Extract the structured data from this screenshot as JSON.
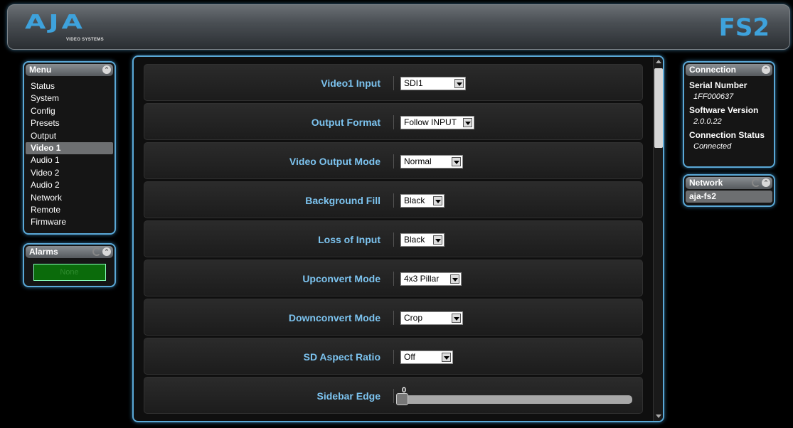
{
  "header": {
    "logo_text": "AJA",
    "logo_sub": "VIDEO SYSTEMS",
    "model": "FS2"
  },
  "menu": {
    "title": "Menu",
    "items": [
      "Status",
      "System",
      "Config",
      "Presets",
      "Output",
      "Video 1",
      "Audio 1",
      "Video 2",
      "Audio 2",
      "Network",
      "Remote",
      "Firmware"
    ],
    "active": "Video 1"
  },
  "alarms": {
    "title": "Alarms",
    "status": "None"
  },
  "connection": {
    "title": "Connection",
    "serial_label": "Serial Number",
    "serial_value": "1FF000637",
    "software_label": "Software Version",
    "software_value": "2.0.0.22",
    "status_label": "Connection Status",
    "status_value": "Connected"
  },
  "network": {
    "title": "Network",
    "host": "aja-fs2"
  },
  "settings": [
    {
      "label": "Video1 Input",
      "value": "SDI1"
    },
    {
      "label": "Output Format",
      "value": "Follow INPUT"
    },
    {
      "label": "Video Output Mode",
      "value": "Normal"
    },
    {
      "label": "Background Fill",
      "value": "Black"
    },
    {
      "label": "Loss of Input",
      "value": "Black"
    },
    {
      "label": "Upconvert Mode",
      "value": "4x3 Pillar"
    },
    {
      "label": "Downconvert Mode",
      "value": "Crop"
    },
    {
      "label": "SD Aspect Ratio",
      "value": "Off"
    }
  ],
  "sidebar_edge": {
    "label": "Sidebar Edge",
    "value": "0"
  },
  "colors": {
    "accent": "#3ea2dc",
    "label": "#7cc3ef",
    "panel_border": "#5aa8d6"
  }
}
